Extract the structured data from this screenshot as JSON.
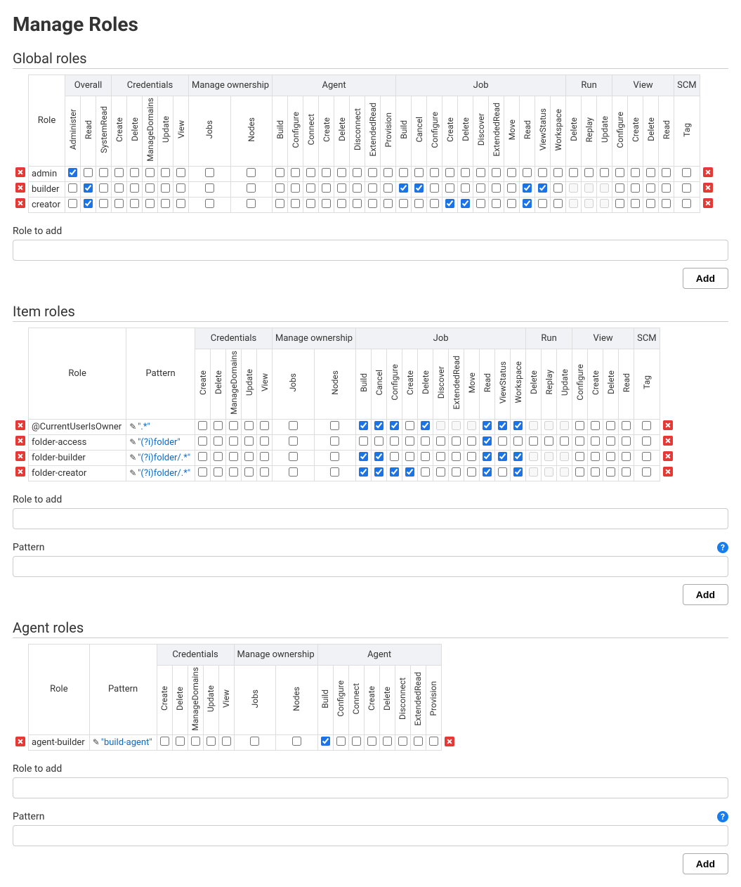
{
  "title": "Manage Roles",
  "labels": {
    "role_to_add": "Role to add",
    "pattern": "Pattern",
    "add": "Add",
    "role_header": "Role",
    "pattern_header": "Pattern"
  },
  "global": {
    "heading": "Global roles",
    "groups": [
      {
        "name": "Overall",
        "perms": [
          "Administer",
          "Read",
          "SystemRead"
        ]
      },
      {
        "name": "Credentials",
        "perms": [
          "Create",
          "Delete",
          "ManageDomains",
          "Update",
          "View"
        ]
      },
      {
        "name": "Manage ownership",
        "perms": [
          "Jobs",
          "Nodes"
        ]
      },
      {
        "name": "Agent",
        "perms": [
          "Build",
          "Configure",
          "Connect",
          "Create",
          "Delete",
          "Disconnect",
          "ExtendedRead",
          "Provision"
        ]
      },
      {
        "name": "Job",
        "perms": [
          "Build",
          "Cancel",
          "Configure",
          "Create",
          "Delete",
          "Discover",
          "ExtendedRead",
          "Move",
          "Read",
          "ViewStatus",
          "Workspace"
        ]
      },
      {
        "name": "Run",
        "perms": [
          "Delete",
          "Replay",
          "Update"
        ]
      },
      {
        "name": "View",
        "perms": [
          "Configure",
          "Create",
          "Delete",
          "Read"
        ]
      },
      {
        "name": "SCM",
        "perms": [
          "Tag"
        ]
      }
    ],
    "roles": [
      {
        "name": "admin",
        "disabled": [],
        "checked": [
          "Overall/Administer"
        ]
      },
      {
        "name": "builder",
        "disabled": [
          "Run/Delete",
          "Run/Replay",
          "Run/Update"
        ],
        "checked": [
          "Overall/Read",
          "Job/Build",
          "Job/Cancel",
          "Job/Read",
          "Job/ViewStatus"
        ]
      },
      {
        "name": "creator",
        "disabled": [
          "Run/Delete",
          "Run/Replay",
          "Run/Update"
        ],
        "checked": [
          "Overall/Read",
          "Job/Create",
          "Job/Delete",
          "Job/Read"
        ]
      }
    ]
  },
  "item": {
    "heading": "Item roles",
    "groups": [
      {
        "name": "Credentials",
        "perms": [
          "Create",
          "Delete",
          "ManageDomains",
          "Update",
          "View"
        ]
      },
      {
        "name": "Manage ownership",
        "perms": [
          "Jobs",
          "Nodes"
        ]
      },
      {
        "name": "Job",
        "perms": [
          "Build",
          "Cancel",
          "Configure",
          "Create",
          "Delete",
          "Discover",
          "ExtendedRead",
          "Move",
          "Read",
          "ViewStatus",
          "Workspace"
        ]
      },
      {
        "name": "Run",
        "perms": [
          "Delete",
          "Replay",
          "Update"
        ]
      },
      {
        "name": "View",
        "perms": [
          "Configure",
          "Create",
          "Delete",
          "Read"
        ]
      },
      {
        "name": "SCM",
        "perms": [
          "Tag"
        ]
      }
    ],
    "roles": [
      {
        "name": "@CurrentUserIsOwner",
        "pattern": "\".*\"",
        "disabled": [
          "Job/Discover",
          "Job/ExtendedRead",
          "Job/Move",
          "Run/Delete",
          "Run/Replay",
          "Run/Update"
        ],
        "checked": [
          "Job/Build",
          "Job/Cancel",
          "Job/Configure",
          "Job/Delete",
          "Job/Read",
          "Job/ViewStatus",
          "Job/Workspace"
        ]
      },
      {
        "name": "folder-access",
        "pattern": "\"(?i)folder\"",
        "disabled": [],
        "checked": [
          "Job/Read"
        ]
      },
      {
        "name": "folder-builder",
        "pattern": "\"(?i)folder/.*\"",
        "disabled": [
          "Run/Delete",
          "Run/Replay",
          "Run/Update"
        ],
        "checked": [
          "Job/Build",
          "Job/Cancel",
          "Job/Read",
          "Job/ViewStatus",
          "Job/Workspace"
        ]
      },
      {
        "name": "folder-creator",
        "pattern": "\"(?i)folder/.*\"",
        "disabled": [
          "Run/Delete",
          "Run/Replay",
          "Run/Update"
        ],
        "checked": [
          "Job/Build",
          "Job/Cancel",
          "Job/Configure",
          "Job/Create",
          "Job/Read",
          "Job/Workspace"
        ]
      }
    ]
  },
  "agent": {
    "heading": "Agent roles",
    "groups": [
      {
        "name": "Credentials",
        "perms": [
          "Create",
          "Delete",
          "ManageDomains",
          "Update",
          "View"
        ]
      },
      {
        "name": "Manage ownership",
        "perms": [
          "Jobs",
          "Nodes"
        ]
      },
      {
        "name": "Agent",
        "perms": [
          "Build",
          "Configure",
          "Connect",
          "Create",
          "Delete",
          "Disconnect",
          "ExtendedRead",
          "Provision"
        ]
      }
    ],
    "roles": [
      {
        "name": "agent-builder",
        "pattern": "\"build-agent\"",
        "disabled": [],
        "checked": [
          "Agent/Build"
        ]
      }
    ]
  }
}
